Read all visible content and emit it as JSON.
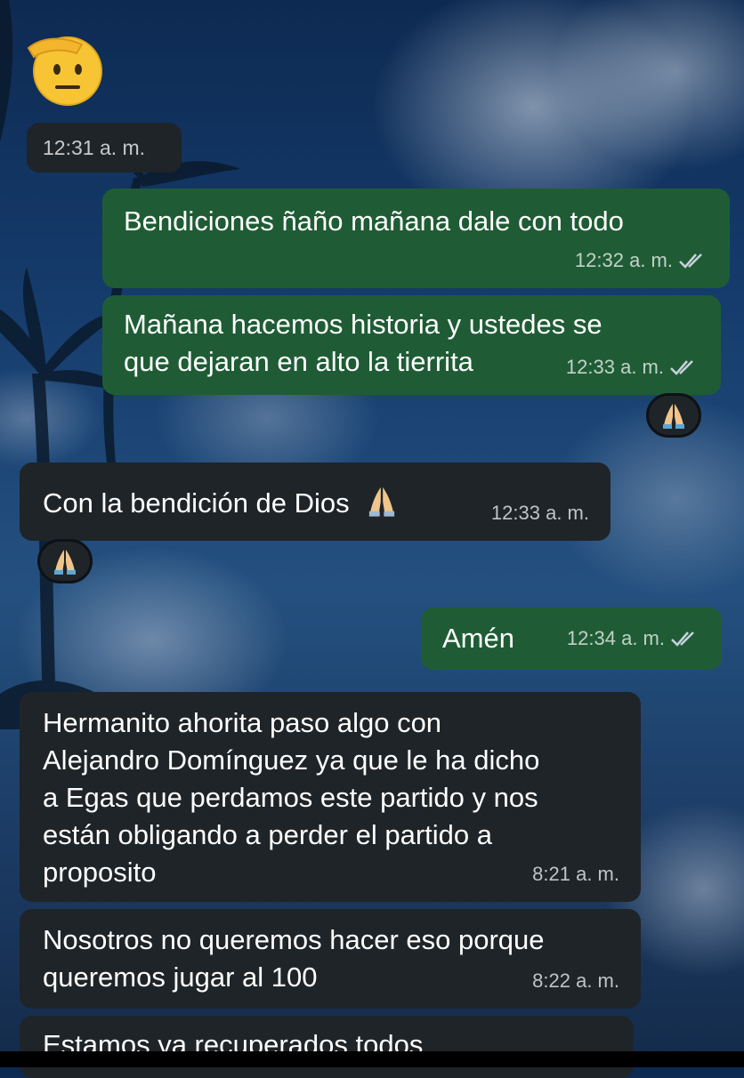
{
  "top": {
    "emoji": "saluting-face-icon",
    "time": "12:31 a. m."
  },
  "messages": [
    {
      "direction": "out",
      "text": "Bendiciones ñaño mañana dale con todo",
      "time": "12:32 a. m.",
      "status": "read-double-check"
    },
    {
      "direction": "out",
      "text": "Mañana hacemos historia y ustedes se\nque dejaran en alto la tierrita",
      "time": "12:33 a. m.",
      "status": "read-double-check",
      "reaction": "folded-hands-icon"
    },
    {
      "direction": "in",
      "text": "Con la bendición de Dios",
      "emoji": "folded-hands-icon",
      "time": "12:33 a. m.",
      "reaction": "folded-hands-icon"
    },
    {
      "direction": "out",
      "text": "Amén",
      "time": "12:34 a. m.",
      "status": "read-double-check"
    },
    {
      "direction": "in",
      "text": "Hermanito ahorita paso algo con\nAlejandro Domínguez ya que le ha dicho\na Egas que perdamos este partido y nos\nestán obligando a perder el partido a\nproposito",
      "time": "8:21 a. m."
    },
    {
      "direction": "in",
      "text": "Nosotros no queremos hacer eso porque\nqueremos jugar al 100",
      "time": "8:22 a. m."
    },
    {
      "direction": "in",
      "text": "Estamos ya recuperados todos",
      "time": ""
    }
  ],
  "colors": {
    "incoming_bubble": "#1f2428",
    "outgoing_bubble": "#1f5c35",
    "read_tick": "#c8d2dc"
  }
}
